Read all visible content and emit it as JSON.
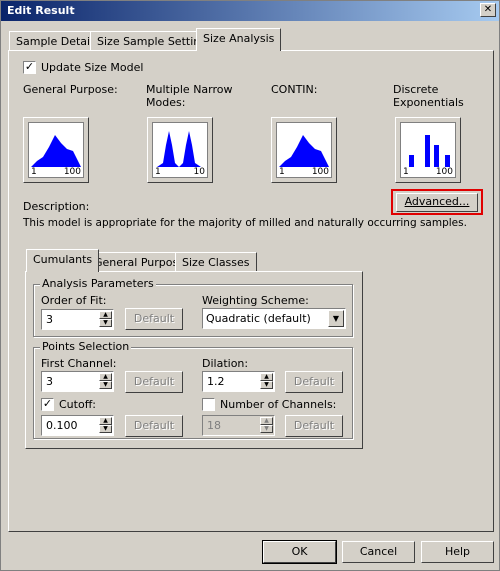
{
  "window": {
    "title": "Edit Result",
    "close_glyph": "✕"
  },
  "tabs": [
    "Sample Details",
    "Size Sample Settings",
    "Size Analysis"
  ],
  "update_size_model": {
    "label": "Update Size Model",
    "checked": true
  },
  "models": [
    {
      "title_line1": "General Purpose:",
      "title_line2": "",
      "lo": "1",
      "hi": "100"
    },
    {
      "title_line1": "Multiple Narrow",
      "title_line2": "Modes:",
      "lo": "1",
      "hi": "10"
    },
    {
      "title_line1": "CONTIN:",
      "title_line2": "",
      "lo": "1",
      "hi": "100"
    },
    {
      "title_line1": "Discrete",
      "title_line2": "Exponentials",
      "lo": "1",
      "hi": "100"
    }
  ],
  "advanced_button": "Advanced...",
  "description": {
    "label": "Description:",
    "text": "This model is appropriate for the majority of milled and naturally occurring samples."
  },
  "subtabs": [
    "Cumulants",
    "General Purpose",
    "Size Classes"
  ],
  "analysis_parameters": {
    "legend": "Analysis Parameters",
    "order_of_fit_label": "Order of Fit:",
    "order_of_fit_value": "3",
    "default_label": "Default",
    "weighting_label": "Weighting Scheme:",
    "weighting_value": "Quadratic (default)"
  },
  "points_selection": {
    "legend": "Points Selection",
    "first_channel_label": "First Channel:",
    "first_channel_value": "3",
    "dilation_label": "Dilation:",
    "dilation_value": "1.2",
    "cutoff_label": "Cutoff:",
    "cutoff_checked": true,
    "cutoff_value": "0.100",
    "num_channels_label": "Number of Channels:",
    "num_channels_checked": false,
    "num_channels_value": "18",
    "default_label": "Default"
  },
  "footer": {
    "ok": "OK",
    "cancel": "Cancel",
    "help": "Help"
  },
  "colors": {
    "accent_highlight": "#e00000",
    "chart_fill": "#0000ff"
  }
}
